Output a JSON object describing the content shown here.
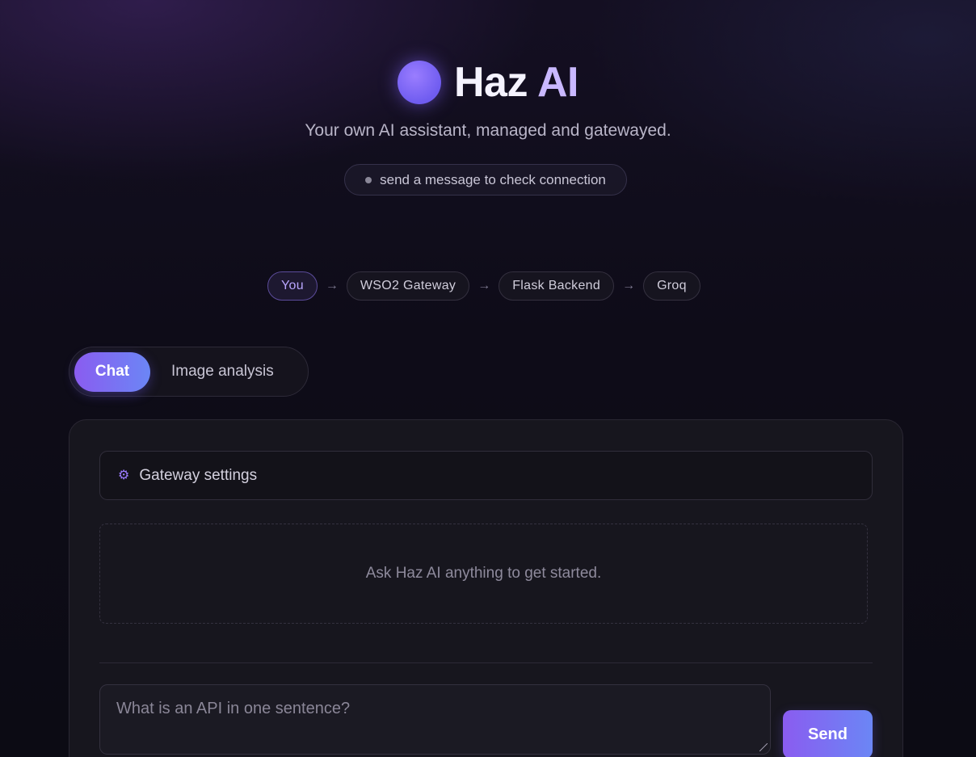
{
  "brand": {
    "title_main": "Haz ",
    "title_accent": "AI",
    "tagline": "Your own AI assistant, managed and gatewayed.",
    "status": "send a message to check connection"
  },
  "flow": {
    "nodes": [
      "You",
      "WSO2 Gateway",
      "Flask Backend",
      "Groq"
    ],
    "arrow": "→"
  },
  "tabs": [
    {
      "label": "Chat",
      "active": true
    },
    {
      "label": "Image analysis",
      "active": false
    }
  ],
  "card": {
    "settings_label": "Gateway settings",
    "settings_icon": "gear-icon",
    "empty_text": "Ask Haz AI anything to get started.",
    "composer_placeholder": "What is an API in one sentence?",
    "send_label": "Send"
  },
  "colors": {
    "accent_start": "#8a5cf0",
    "accent_end": "#6b86f5",
    "background": "#0e0c18"
  }
}
